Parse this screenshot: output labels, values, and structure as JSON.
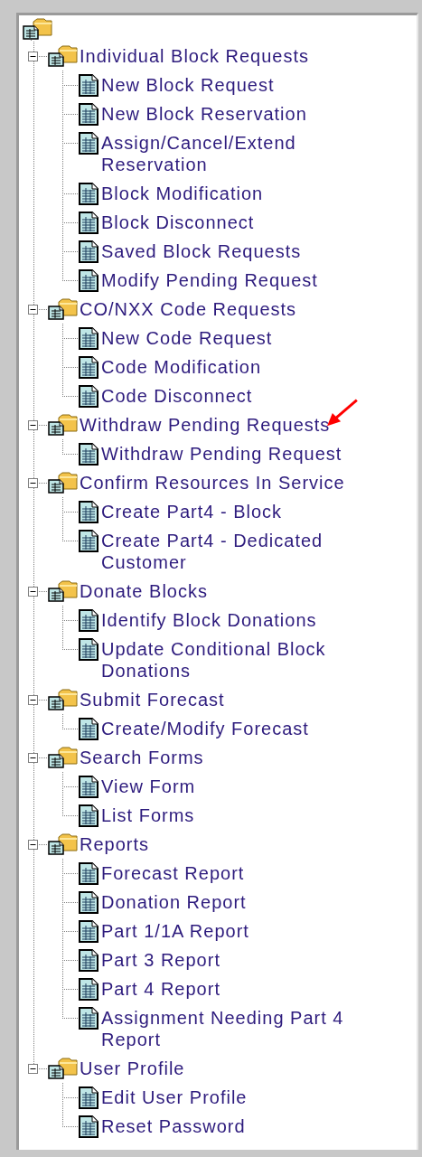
{
  "groups": [
    {
      "label": "Individual Block Requests",
      "expanded": true,
      "marked": false,
      "children": [
        {
          "label": "New Block Request"
        },
        {
          "label": "New Block Reservation"
        },
        {
          "label": "Assign/Cancel/Extend Reservation"
        },
        {
          "label": "Block Modification"
        },
        {
          "label": "Block Disconnect"
        },
        {
          "label": "Saved Block Requests"
        },
        {
          "label": "Modify Pending Request"
        }
      ]
    },
    {
      "label": "CO/NXX Code Requests",
      "expanded": true,
      "marked": false,
      "children": [
        {
          "label": "New Code Request"
        },
        {
          "label": "Code Modification"
        },
        {
          "label": "Code Disconnect"
        }
      ]
    },
    {
      "label": "Withdraw Pending Requests",
      "expanded": true,
      "marked": true,
      "children": [
        {
          "label": "Withdraw Pending Request"
        }
      ]
    },
    {
      "label": "Confirm Resources In Service",
      "expanded": true,
      "marked": false,
      "children": [
        {
          "label": "Create Part4 - Block"
        },
        {
          "label": "Create Part4 - Dedicated Customer"
        }
      ]
    },
    {
      "label": "Donate Blocks",
      "expanded": true,
      "marked": false,
      "children": [
        {
          "label": "Identify Block Donations"
        },
        {
          "label": "Update Conditional Block Donations"
        }
      ]
    },
    {
      "label": "Submit Forecast",
      "expanded": true,
      "marked": false,
      "children": [
        {
          "label": "Create/Modify Forecast"
        }
      ]
    },
    {
      "label": "Search Forms",
      "expanded": true,
      "marked": false,
      "children": [
        {
          "label": "View Form"
        },
        {
          "label": "List Forms"
        }
      ]
    },
    {
      "label": "Reports",
      "expanded": true,
      "marked": false,
      "children": [
        {
          "label": "Forecast Report"
        },
        {
          "label": "Donation Report"
        },
        {
          "label": "Part 1/1A Report"
        },
        {
          "label": "Part 3 Report"
        },
        {
          "label": "Part 4 Report"
        },
        {
          "label": "Assignment Needing Part 4 Report"
        }
      ]
    },
    {
      "label": "User Profile",
      "expanded": true,
      "marked": false,
      "children": [
        {
          "label": "Edit User Profile"
        },
        {
          "label": "Reset Password"
        }
      ]
    }
  ]
}
